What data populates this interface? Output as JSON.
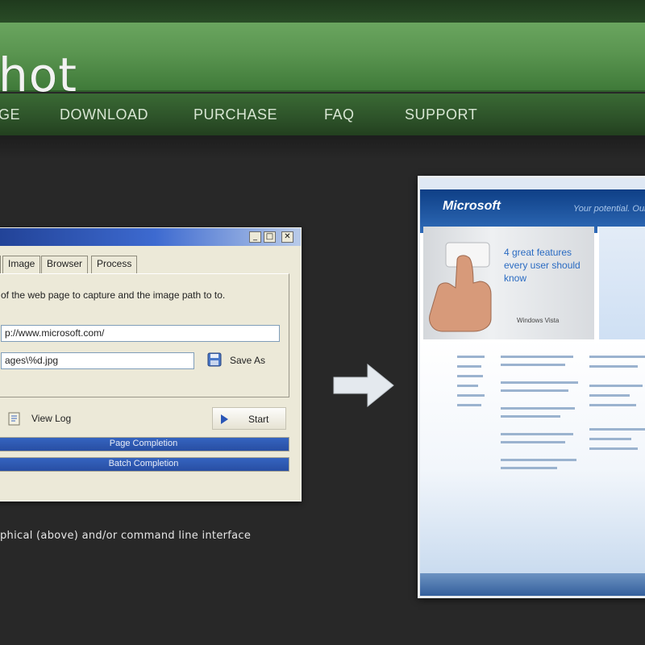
{
  "header": {
    "brand_text": "hot"
  },
  "nav": {
    "items": [
      {
        "label": "GE"
      },
      {
        "label": "DOWNLOAD"
      },
      {
        "label": "PURCHASE"
      },
      {
        "label": "FAQ"
      },
      {
        "label": "SUPPORT"
      }
    ]
  },
  "app_window": {
    "controls": {
      "minimize": "_",
      "maximize": "□",
      "close": "✕"
    },
    "tabs": [
      {
        "label": "|"
      },
      {
        "label": "Image"
      },
      {
        "label": "Browser"
      },
      {
        "label": "Process"
      }
    ],
    "description": "of the web page to capture and the image path to to.",
    "url_value": "p://www.microsoft.com/",
    "path_value": "ages\\%d.jpg",
    "save_as_label": "Save As",
    "view_log_label": "View Log",
    "start_label": "Start",
    "progress": [
      {
        "label": "Page Completion",
        "fraction": 1.0
      },
      {
        "label": "Batch Completion",
        "fraction": 1.0
      }
    ],
    "accent": "#2a56b6"
  },
  "caption": "phical (above) and/or command line interface",
  "browser": {
    "logo": "Microsoft",
    "tagline": "Your potential. Our pa",
    "hero_text": "4 great features every user should know",
    "product": "Windows Vista"
  },
  "colors": {
    "banner_green": "#5a9550",
    "nav_green": "#2d5229",
    "background": "#282828"
  }
}
